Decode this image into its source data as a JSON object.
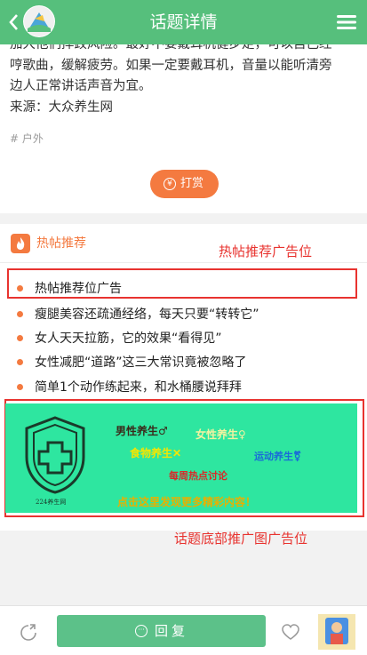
{
  "header": {
    "title": "话题详情"
  },
  "article": {
    "lines": [
      "加大他们摔跤风险。最好不要戴耳机健步走，可以自己经",
      "哼歌曲，缓解疲劳。如果一定要戴耳机，音量以能听清旁",
      "边人正常讲话声音为宜。",
      "来源：大众养生网"
    ],
    "tag": "# 户外",
    "reward_icon": "¥",
    "reward_label": "打赏"
  },
  "hot": {
    "title": "热帖推荐",
    "note_hot": "热帖推荐广告位",
    "items": [
      "热帖推荐位广告",
      "瘦腿美容还疏通经络，每天只要“转转它”",
      "女人天天拉筋，它的效果“看得见”",
      "女性减肥“道路”这三大常识竟被忽略了",
      "简单1个动作练起来，和水桶腰说拜拜"
    ],
    "note_banner": "话题底部推广图广告位"
  },
  "banner": {
    "logo_text": "224养生网",
    "t1": "男性养生♂",
    "t2": "女性养生♀",
    "t3": "食物养生✕",
    "t4": "运动养生⚧",
    "t5": "每周热点讨论",
    "t6": "点击这里发现更多精彩内容！"
  },
  "bottom": {
    "reply_label": "回复"
  },
  "colors": {
    "brand": "#56bf7c",
    "accent": "#f47a40",
    "annotation": "#e8332f",
    "banner": "#2ee6a0"
  }
}
